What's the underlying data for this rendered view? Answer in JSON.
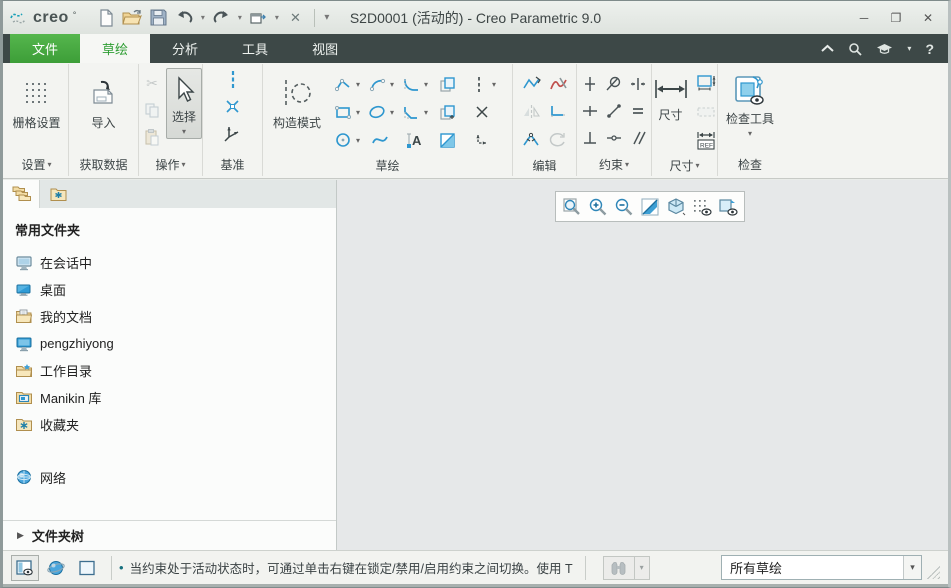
{
  "titlebar": {
    "logo_text": "creo",
    "title": "S2D0001 (活动的) - Creo Parametric 9.0",
    "controls": {
      "minimize": "─",
      "maximize": "❐",
      "close": "✕"
    }
  },
  "glyphs": {
    "dropdown": "▾",
    "expander": "▶",
    "bullet": "•",
    "help": "?",
    "close_small": "✕",
    "cut": "✂"
  },
  "tabs": {
    "file": "文件",
    "sketch": "草绘",
    "analysis": "分析",
    "tools": "工具",
    "view": "视图"
  },
  "ribbon": {
    "groups": {
      "settings": {
        "label": "设置",
        "button": "栅格设置"
      },
      "get_data": {
        "label": "获取数据",
        "button": "导入"
      },
      "operations": {
        "label": "操作",
        "button": "选择"
      },
      "datum": {
        "label": "基准"
      },
      "sketch": {
        "label": "草绘",
        "button": "构造模式"
      },
      "edit": {
        "label": "编辑"
      },
      "constrain": {
        "label": "约束"
      },
      "dimension": {
        "label": "尺寸",
        "button": "尺寸",
        "ref_label": "REF"
      },
      "inspect": {
        "label": "检查",
        "button": "检查工具"
      }
    },
    "icon_names": {
      "settings": [
        "grid-settings-icon"
      ],
      "get_data": [
        "import-icon"
      ],
      "operations": [
        "cut-icon",
        "copy-icon",
        "paste-icon",
        "select-cursor-icon"
      ],
      "datum": [
        "centerline-icon",
        "point-icon",
        "coordinate-system-icon"
      ],
      "sketch": [
        "construction-mode-icon",
        "line-icon",
        "arc-icon",
        "fillet-icon",
        "offset-icon",
        "centerline-icon",
        "rectangle-icon",
        "ellipse-icon",
        "chamfer-icon",
        "thicken-icon",
        "point-icon",
        "circle-icon",
        "spline-icon",
        "text-icon",
        "palette-icon",
        "import-coordsys-icon"
      ],
      "edit": [
        "modify-icon",
        "delete-segment-icon",
        "mirror-icon",
        "corner-icon",
        "divide-icon",
        "rotate-resize-icon"
      ],
      "constrain": [
        "vertical-icon",
        "tangent-icon",
        "midpoint-icon",
        "horizontal-icon",
        "coincident-icon",
        "equal-icon",
        "perpendicular-icon",
        "symmetric-icon",
        "parallel-icon"
      ],
      "dimension": [
        "dimension-icon",
        "perimeter-icon",
        "baseline-icon",
        "reference-dim-icon"
      ],
      "inspect": [
        "inspect-tools-icon"
      ]
    }
  },
  "graphics_toolbar": [
    "refit-icon",
    "zoom-in-icon",
    "zoom-out-icon",
    "repaint-icon",
    "display-style-icon",
    "sketcher-filters-icon",
    "sketch-view-icon"
  ],
  "navigator": {
    "header": "常用文件夹",
    "items": [
      {
        "label": "在会话中"
      },
      {
        "label": "桌面"
      },
      {
        "label": "我的文档"
      },
      {
        "label": "pengzhiyong"
      },
      {
        "label": "工作目录"
      },
      {
        "label": "Manikin 库"
      },
      {
        "label": "收藏夹"
      },
      {
        "label": "网络"
      }
    ],
    "folder_tree_label": "文件夹树"
  },
  "statusbar": {
    "message": "当约束处于活动状态时，可通过单击右键在锁定/禁用/启用约束之间切换。使用 T",
    "filter_value": "所有草绘"
  },
  "colors": {
    "accent_green": "#3f9e38",
    "tab_dark": "#3d4847",
    "icon_blue": "#2e97cf",
    "graphics_bg": "#e6e8e9"
  }
}
